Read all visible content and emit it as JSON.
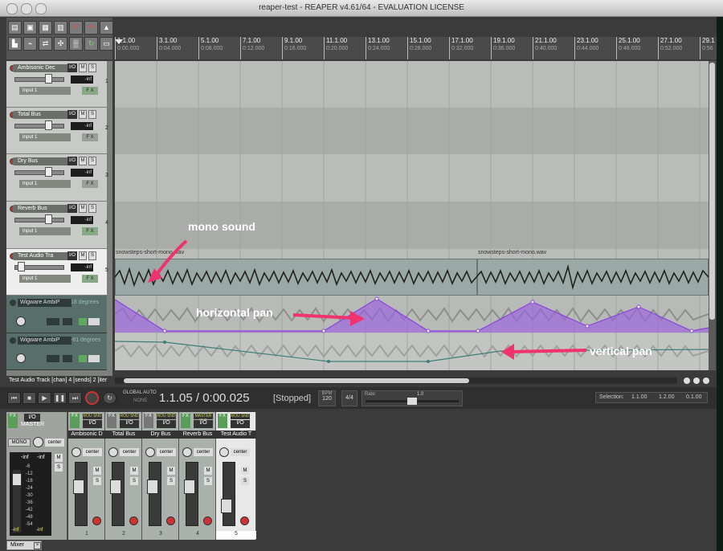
{
  "window": {
    "title": "reaper-test - REAPER v4.61/64 - EVALUATION LICENSE"
  },
  "ruler": {
    "marks": [
      {
        "measure": "1.1.00",
        "time": "0:00.000"
      },
      {
        "measure": "3.1.00",
        "time": "0:04.000"
      },
      {
        "measure": "5.1.00",
        "time": "0:08.000"
      },
      {
        "measure": "7.1.00",
        "time": "0:12.000"
      },
      {
        "measure": "9.1.00",
        "time": "0:16.000"
      },
      {
        "measure": "11.1.00",
        "time": "0:20.000"
      },
      {
        "measure": "13.1.00",
        "time": "0:24.000"
      },
      {
        "measure": "15.1.00",
        "time": "0:28.000"
      },
      {
        "measure": "17.1.00",
        "time": "0:32.000"
      },
      {
        "measure": "19.1.00",
        "time": "0:36.000"
      },
      {
        "measure": "21.1.00",
        "time": "0:40.000"
      },
      {
        "measure": "23.1.00",
        "time": "0:44.000"
      },
      {
        "measure": "25.1.00",
        "time": "0:48.000"
      },
      {
        "measure": "27.1.00",
        "time": "0:52.000"
      },
      {
        "measure": "29.1",
        "time": "0:56"
      }
    ]
  },
  "tracks": [
    {
      "name": "Ambisonic Dec",
      "num": "1",
      "vol": "-inf",
      "input": "Input 1",
      "io": "I/O",
      "mute": "M",
      "solo": "S",
      "fx": "F X"
    },
    {
      "name": "Total Bus",
      "num": "2",
      "vol": "-inf",
      "input": "Input 1",
      "io": "I/O",
      "mute": "M",
      "solo": "S",
      "fx": "F X"
    },
    {
      "name": "Dry Bus",
      "num": "3",
      "vol": "-inf",
      "input": "Input 1",
      "io": "I/O",
      "mute": "M",
      "solo": "S",
      "fx": "F X"
    },
    {
      "name": "Reverb Bus",
      "num": "4",
      "vol": "-inf",
      "input": "Input 1",
      "io": "I/O",
      "mute": "M",
      "solo": "S",
      "fx": "F X"
    },
    {
      "name": "Test Audio Tra",
      "num": "5",
      "vol": "-inf",
      "input": "Input 1",
      "io": "I/O",
      "mute": "M",
      "solo": "S",
      "fx": "F X"
    }
  ],
  "envelopes": [
    {
      "name": "Wigware AmbiP",
      "value": "18 degrees"
    },
    {
      "name": "Wigware AmbiP",
      "value": "-61 degrees"
    }
  ],
  "items": [
    {
      "name": "snowsteps-short-mono.wav"
    },
    {
      "name": "snowsteps-short-mono.wav"
    }
  ],
  "annotations": {
    "mono": "mono sound",
    "hpan": "horizontal pan",
    "vpan": "vertical pan"
  },
  "status_line": "Test Audio Track [chan] 4 [sends] 2 [iter",
  "transport": {
    "global_auto": "GLOBAL AUTO",
    "global_auto_mode": "NONE",
    "position": "1.1.05 / 0:00.025",
    "state": "[Stopped]",
    "bpm_label": "BPM",
    "bpm": "120",
    "timesig": "4/4",
    "rate_label": "Rate:",
    "rate": "1.0",
    "selection_label": "Selection:",
    "sel_start": "1.1.00",
    "sel_end": "1.2.00",
    "sel_len": "0.1.00"
  },
  "mixer": {
    "tab": "Mixer",
    "master": {
      "name": "MASTER",
      "io": "I/O",
      "mono": "MONO",
      "pan": "center",
      "peak_l": "-inf",
      "peak_r": "-inf",
      "fx": "FX",
      "mute": "M",
      "solo": "S",
      "bottom_l": "-inf",
      "bottom_r": "-inf",
      "scale": [
        "-6",
        "-12",
        "-18",
        "-24",
        "-30",
        "-36",
        "-42",
        "-48",
        "-54"
      ]
    },
    "strips": [
      {
        "name": "Ambisonic D",
        "num": "1",
        "pan": "center",
        "io": "I/O",
        "fx": "FX",
        "mute": "M",
        "solo": "S",
        "route": "ROU SND"
      },
      {
        "name": "Total Bus",
        "num": "2",
        "pan": "center",
        "io": "I/O",
        "fx": "FX",
        "mute": "M",
        "solo": "S",
        "route": "ROU SND"
      },
      {
        "name": "Dry Bus",
        "num": "3",
        "pan": "center",
        "io": "I/O",
        "fx": "FX",
        "mute": "M",
        "solo": "S",
        "route": "ROU SND"
      },
      {
        "name": "Reverb Bus",
        "num": "4",
        "pan": "center",
        "io": "I/O",
        "fx": "FX",
        "mute": "M",
        "solo": "S",
        "route": "MASTER SND"
      },
      {
        "name": "Test Audio T",
        "num": "5",
        "pan": "center",
        "io": "I/O",
        "fx": "FX",
        "mute": "M",
        "solo": "S",
        "route": "ROU SND"
      }
    ]
  },
  "colors": {
    "envelope_purple": "#9b5fe0",
    "envelope_teal": "#3e7f79",
    "annotation_pink": "#f0336f",
    "track_bg": "#c7cac6"
  }
}
